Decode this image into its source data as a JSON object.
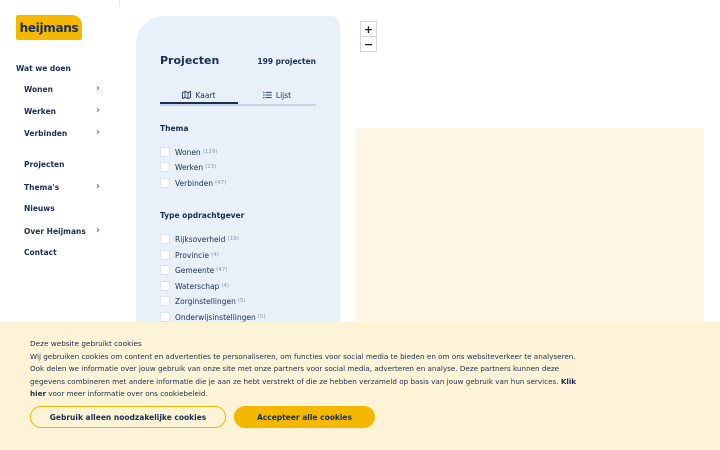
{
  "brand": {
    "logo_text": "heijmans",
    "color": "#f5b800"
  },
  "nav": {
    "heading": "Wat we doen",
    "items": [
      {
        "label": "Wonen",
        "has_submenu": true
      },
      {
        "label": "Werken",
        "has_submenu": true
      },
      {
        "label": "Verbinden",
        "has_submenu": true
      },
      {
        "label": "Projecten",
        "has_submenu": false
      },
      {
        "label": "Thema's",
        "has_submenu": true
      },
      {
        "label": "Nieuws",
        "has_submenu": false
      },
      {
        "label": "Over Heijmans",
        "has_submenu": true
      },
      {
        "label": "Contact",
        "has_submenu": false
      }
    ]
  },
  "panel": {
    "title": "Projecten",
    "count": "199 projecten",
    "tabs": [
      {
        "label": "Kaart",
        "icon": "map-icon",
        "active": true
      },
      {
        "label": "Lijst",
        "icon": "list-icon",
        "active": false
      }
    ],
    "thema": {
      "heading": "Thema",
      "options": [
        {
          "label": "Wonen",
          "count": "(129)"
        },
        {
          "label": "Werken",
          "count": "(23)"
        },
        {
          "label": "Verbinden",
          "count": "(47)"
        }
      ]
    },
    "type": {
      "heading": "Type opdrachtgever",
      "options": [
        {
          "label": "Rijksoverheid",
          "count": "(19)"
        },
        {
          "label": "Provincie",
          "count": "(4)"
        },
        {
          "label": "Gemeente",
          "count": "(47)"
        },
        {
          "label": "Waterschap",
          "count": "(4)"
        },
        {
          "label": "Zorginstellingen",
          "count": "(5)"
        },
        {
          "label": "Onderwijsinstellingen",
          "count": "(5)"
        }
      ]
    }
  },
  "map": {
    "zoom_in": "+",
    "zoom_out": "−"
  },
  "cookie": {
    "title": "Deze website gebruikt cookies",
    "text_before_link": "Wij gebruiken cookies om content en advertenties te personaliseren, om functies voor social media te bieden en om ons websiteverkeer te analyseren. Ook delen we informatie over jouw gebruik van onze site met onze partners voor social media, adverteren en analyse. Deze partners kunnen deze gegevens combineren met andere informatie die je aan ze hebt verstrekt of die ze hebben verzameld op basis van jouw gebruik van hun services. ",
    "link_text": "Klik hier",
    "text_after_link": " voor meer informatie over ons cookiebeleid.",
    "btn_necessary": "Gebruik alleen noodzakelijke cookies",
    "btn_accept": "Accepteer alle cookies"
  }
}
